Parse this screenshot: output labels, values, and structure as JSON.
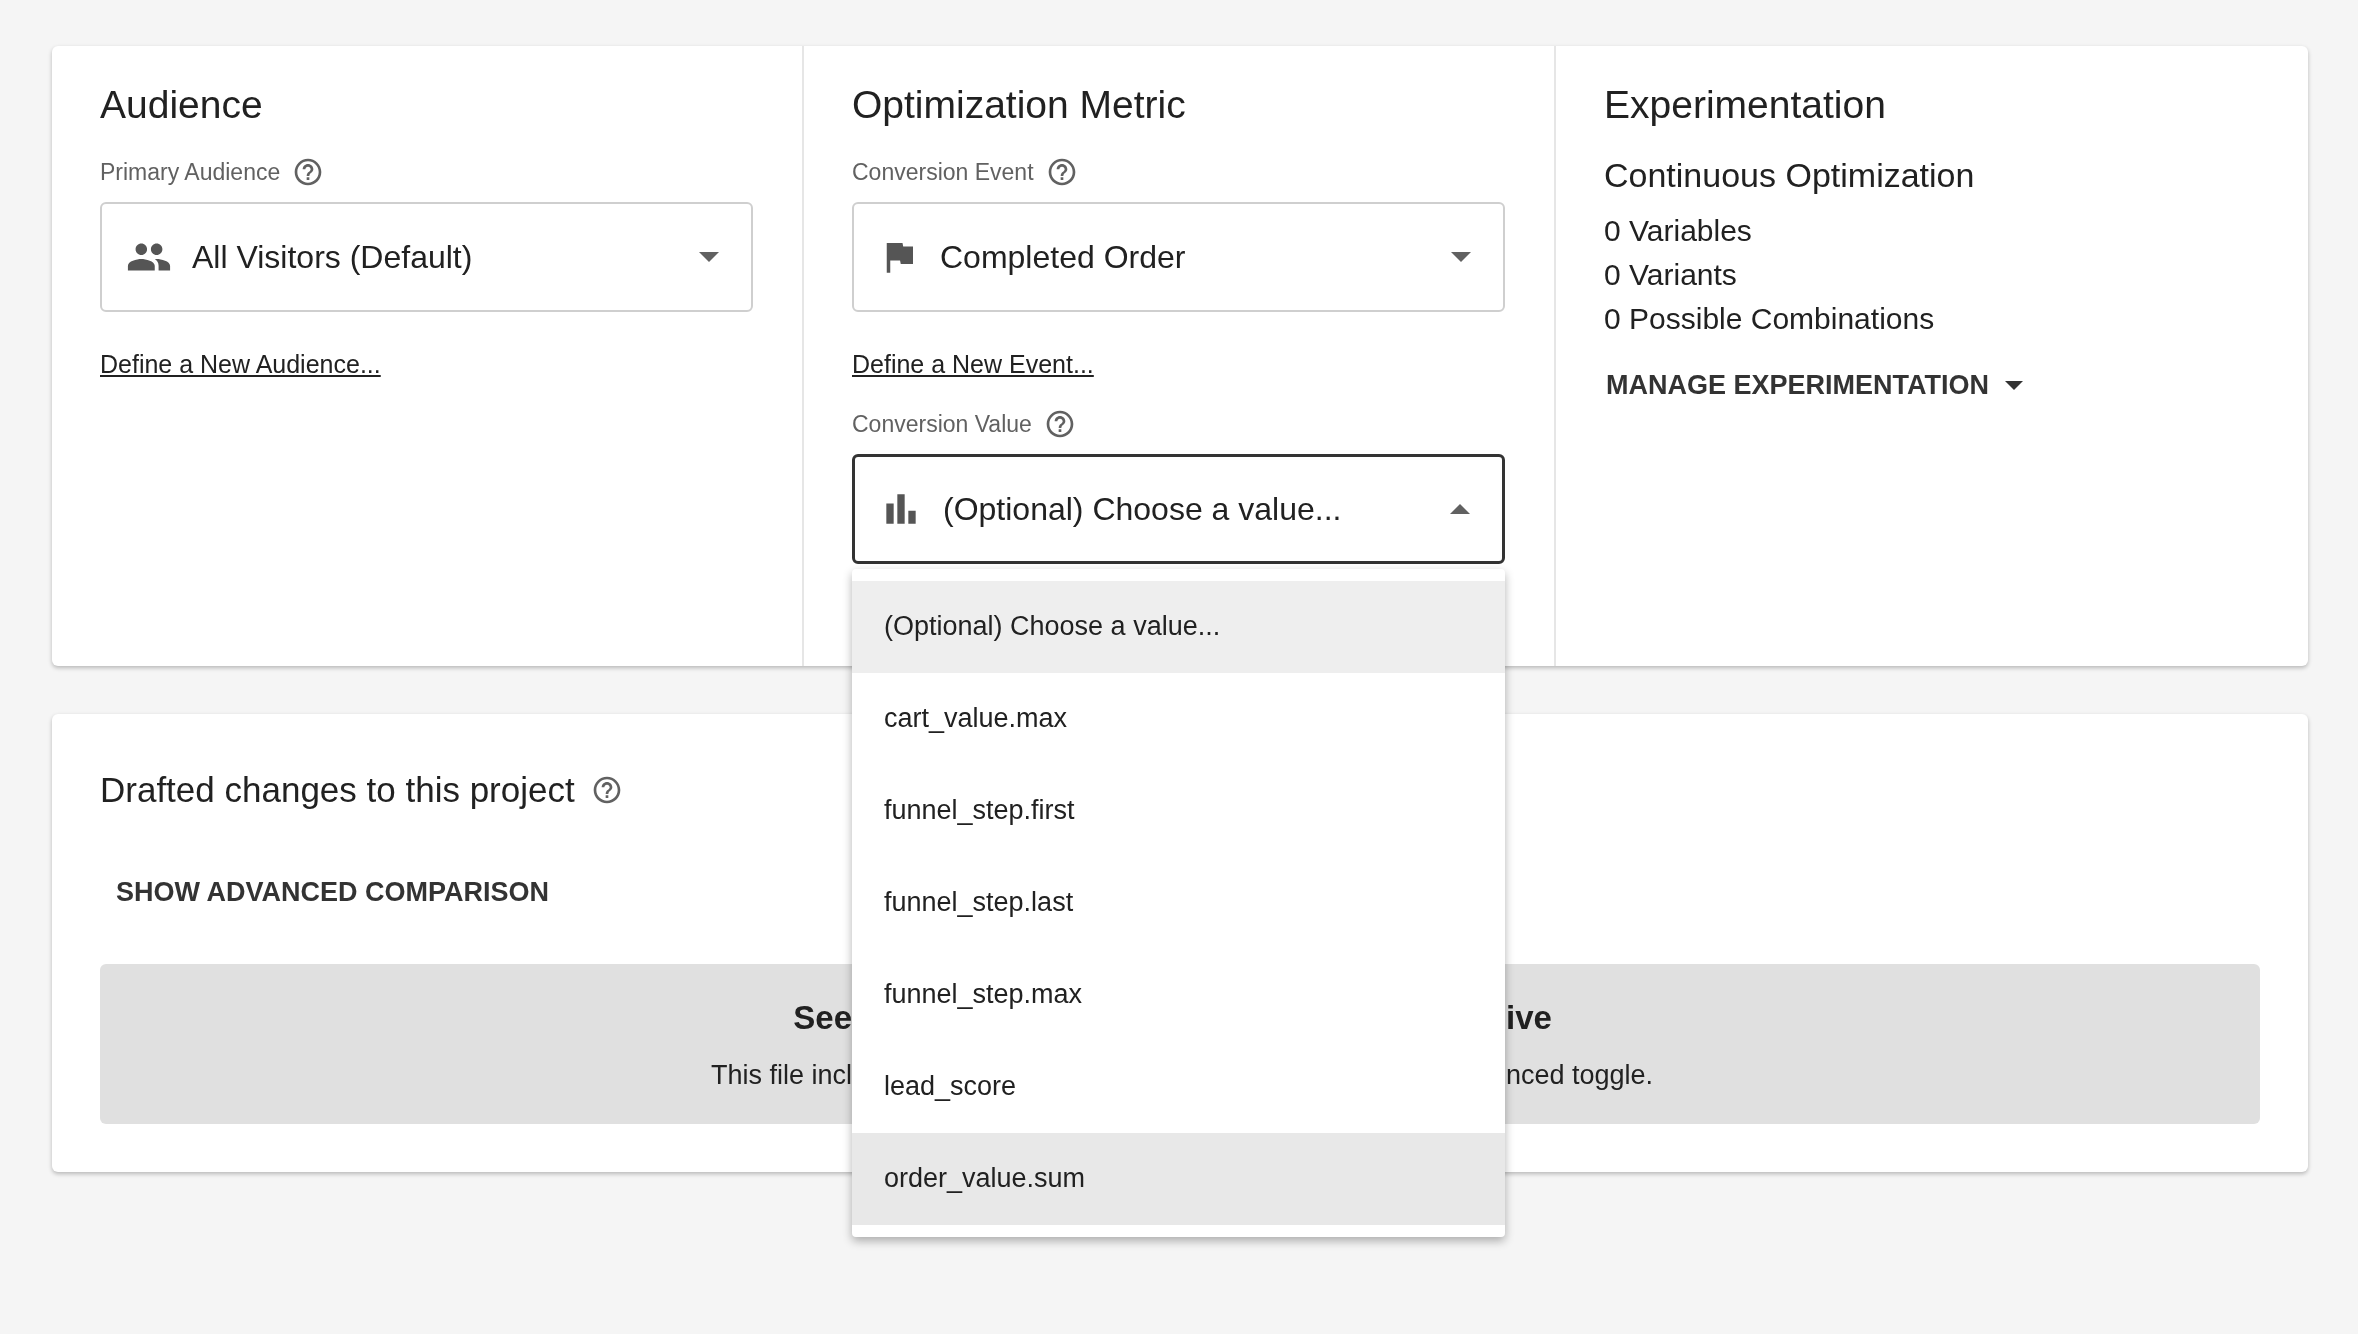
{
  "audience": {
    "title": "Audience",
    "field_label": "Primary Audience",
    "select_value": "All Visitors (Default)",
    "link": "Define a New Audience..."
  },
  "optimization_metric": {
    "title": "Optimization Metric",
    "event_label": "Conversion Event",
    "event_value": "Completed Order",
    "event_link": "Define a New Event...",
    "value_label": "Conversion Value",
    "value_select": {
      "value": "(Optional) Choose a value...",
      "expanded": true,
      "options": [
        {
          "label": "(Optional) Choose a value...",
          "selected": true,
          "hovered": false
        },
        {
          "label": "cart_value.max",
          "selected": false,
          "hovered": false
        },
        {
          "label": "funnel_step.first",
          "selected": false,
          "hovered": false
        },
        {
          "label": "funnel_step.last",
          "selected": false,
          "hovered": false
        },
        {
          "label": "funnel_step.max",
          "selected": false,
          "hovered": false
        },
        {
          "label": "lead_score",
          "selected": false,
          "hovered": false
        },
        {
          "label": "order_value.sum",
          "selected": false,
          "hovered": true
        }
      ]
    }
  },
  "experimentation": {
    "title": "Experimentation",
    "subtitle": "Continuous Optimization",
    "stats": [
      "0 Variables",
      "0 Variants",
      "0 Possible Combinations"
    ],
    "button": "MANAGE EXPERIMENTATION"
  },
  "drafted_changes": {
    "title": "Drafted changes to this project",
    "button": "SHOW ADVANCED COMPARISON",
    "notice": {
      "heading_left": "See",
      "heading_right": "ive",
      "text_left": "This file incl",
      "text_right": "nced toggle."
    }
  }
}
